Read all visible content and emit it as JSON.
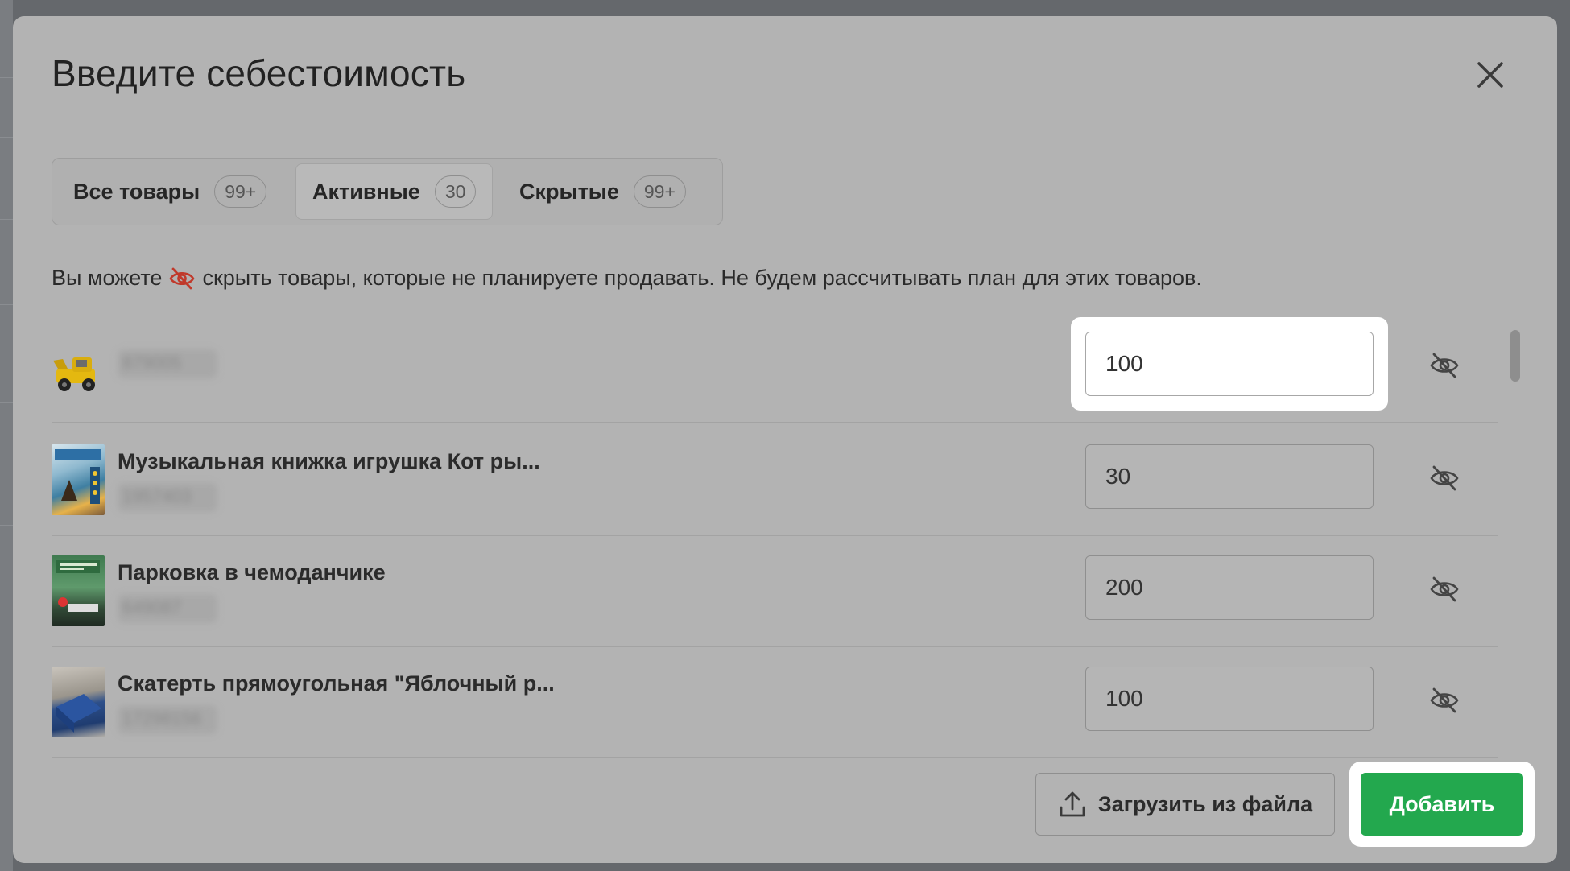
{
  "modal": {
    "title": "Введите себестоимость"
  },
  "tabs": [
    {
      "label": "Все товары",
      "count": "99+"
    },
    {
      "label": "Активные",
      "count": "30"
    },
    {
      "label": "Скрытые",
      "count": "99+"
    }
  ],
  "info": {
    "before": "Вы можете",
    "after": "скрыть товары, которые не планируете продавать. Не будем рассчитывать план для этих товаров."
  },
  "products": [
    {
      "name": "",
      "sku": "879005",
      "cost": "100",
      "icon": "toy-excavator-thumbnail"
    },
    {
      "name": "Музыкальная книжка игрушка Кот ры...",
      "sku": "1957403",
      "cost": "30",
      "icon": "music-book-thumbnail"
    },
    {
      "name": "Парковка в чемоданчике",
      "sku": "649087",
      "cost": "200",
      "icon": "parking-case-thumbnail"
    },
    {
      "name": "Скатерть прямоугольная \"Яблочный р...",
      "sku": "17298156",
      "cost": "100",
      "icon": "tablecloth-thumbnail"
    }
  ],
  "footer": {
    "upload_label": "Загрузить из файла",
    "add_label": "Добавить"
  },
  "colors": {
    "accent_green": "#23a84e",
    "hide_icon_red": "#c0392b"
  }
}
